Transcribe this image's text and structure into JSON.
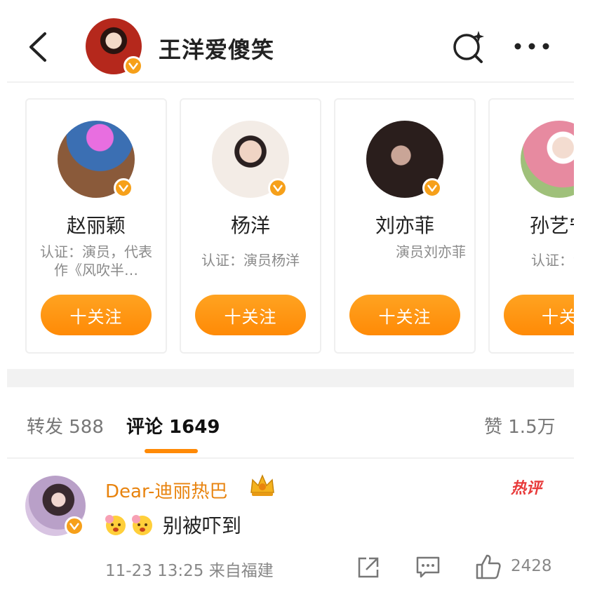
{
  "header": {
    "title": "王洋爱傻笑",
    "back_icon": "chevron-left-icon",
    "search_icon": "search-sparkle-icon",
    "more_icon": "more-dots-icon",
    "verified_color": "#f6a01a"
  },
  "recommendations": [
    {
      "name": "赵丽颖",
      "desc": "认证：演员，代表作《风吹半…",
      "follow": "十关注"
    },
    {
      "name": "杨洋",
      "desc": "认证：演员杨洋",
      "follow": "十关注"
    },
    {
      "name": "刘亦菲",
      "desc": "演员刘亦菲",
      "follow": "十关注"
    },
    {
      "name": "孙艺宁",
      "desc": "认证：演",
      "follow": "十关"
    }
  ],
  "tabs": {
    "repost": "转发 588",
    "comment": "评论 1649",
    "like": "赞 1.5万",
    "active_color": "#ff8a06"
  },
  "comment": {
    "user": "Dear-迪丽热巴",
    "hot_label": "热评",
    "text": "别被吓到",
    "meta": "11-23 13:25  来自福建",
    "likes": "2428",
    "name_color": "#e8830e"
  }
}
